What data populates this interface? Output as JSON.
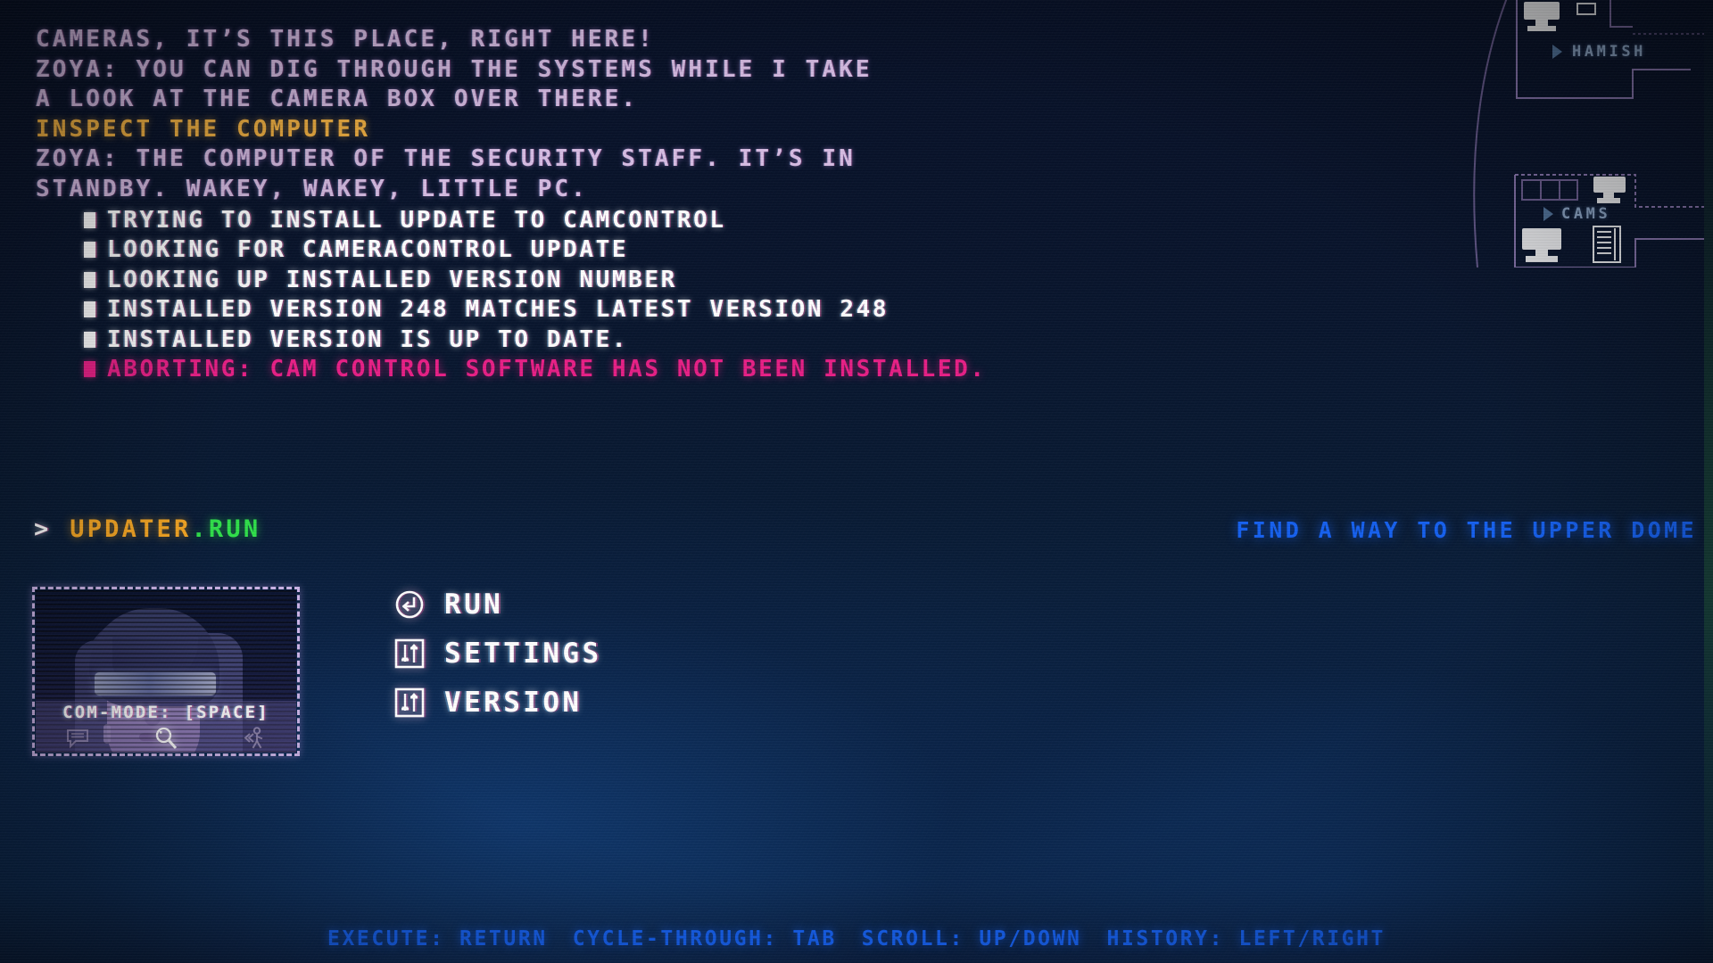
{
  "log": {
    "dialogue": [
      {
        "text": "CAMERAS, IT’S THIS PLACE, RIGHT HERE!",
        "style": "dialog"
      },
      {
        "text": "ZOYA: YOU CAN DIG THROUGH THE SYSTEMS WHILE I TAKE",
        "style": "dialog"
      },
      {
        "text": "A LOOK AT THE CAMERA BOX OVER THERE.",
        "style": "dialog"
      },
      {
        "text": "INSPECT THE COMPUTER",
        "style": "objective"
      },
      {
        "text": "ZOYA: THE COMPUTER OF THE SECURITY STAFF. IT’S IN",
        "style": "dialog"
      },
      {
        "text": "STANDBY. WAKEY, WAKEY, LITTLE PC.",
        "style": "dialog"
      }
    ],
    "entries": [
      {
        "text": "TRYING TO INSTALL UPDATE TO CAMCONTROL",
        "level": "ok"
      },
      {
        "text": "LOOKING FOR CAMERACONTROL UPDATE",
        "level": "ok"
      },
      {
        "text": "LOOKING UP INSTALLED VERSION NUMBER",
        "level": "ok"
      },
      {
        "text": "INSTALLED VERSION 248 MATCHES LATEST VERSION 248",
        "level": "ok"
      },
      {
        "text": "INSTALLED VERSION IS UP TO DATE.",
        "level": "ok"
      },
      {
        "text": "ABORTING: CAM CONTROL SOFTWARE HAS NOT BEEN INSTALLED.",
        "level": "error"
      }
    ]
  },
  "prompt": {
    "caret": ">",
    "command_base": "UPDATER",
    "command_ext": ".RUN",
    "full_command": "UPDATER.RUN"
  },
  "objective": {
    "text": "FIND A WAY TO THE UPPER DOME"
  },
  "menu": {
    "items": [
      {
        "label": "RUN",
        "icon": "enter-return-icon"
      },
      {
        "label": "SETTINGS",
        "icon": "sliders-icon"
      },
      {
        "label": "VERSION",
        "icon": "sliders-icon"
      }
    ]
  },
  "portrait": {
    "com_mode_label": "COM-MODE: [SPACE]",
    "icons": [
      {
        "name": "speech-bubble-icon",
        "state": "inactive"
      },
      {
        "name": "magnifier-icon",
        "state": "active"
      },
      {
        "name": "move-character-icon",
        "state": "inactive"
      }
    ]
  },
  "minimap": {
    "rooms": [
      {
        "label": "HAMISH"
      },
      {
        "label": "CAMS"
      }
    ]
  },
  "hints": [
    "EXECUTE: RETURN",
    "CYCLE-THROUGH: TAB",
    "SCROLL: UP/DOWN",
    "HISTORY: LEFT/RIGHT"
  ],
  "colors": {
    "dialog": "#d7bde4",
    "objective_inline": "#f5b342",
    "log_ok": "#ffffff",
    "log_error": "#e81f86",
    "command_base": "#f5a623",
    "command_ext": "#2fe04a",
    "hint_blue": "#1560f0",
    "minimap_label": "#8fa8c8"
  }
}
